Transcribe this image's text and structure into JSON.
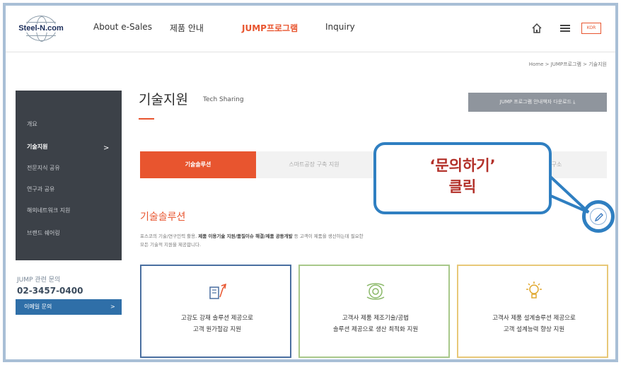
{
  "header": {
    "logo_text": "Steel-N.com",
    "nav": [
      "About e-Sales",
      "제품 안내",
      "JUMP프로그램",
      "Inquiry"
    ],
    "lang_label": "KOR"
  },
  "breadcrumb": "Home  >  JUMP프로그램  >  기술지원",
  "sidebar": {
    "items": [
      "개요",
      "기술지원",
      "전문지식 공유",
      "연구과 공유",
      "해외네트워크 지원",
      "브랜드 쉐어링"
    ],
    "contact_label": "JUMP 관련 문의",
    "contact_phone": "02-3457-0400",
    "email_button": "이메일 문의"
  },
  "main": {
    "title": "기술지원",
    "subtitle": "Tech Sharing",
    "download_button": "JUMP 프로그램 안내책자 다운로드  ⤓",
    "tabs": [
      "기술솔루션",
      "스마트공장 구축 지원",
      "",
      "고전연구소"
    ],
    "section_title": "기술솔루션",
    "description_line1_a": "포스코의 기술/연구인력 활용, ",
    "description_line1_b": "제품 이용기술 지원/품질이슈 해결/제품 공동개발",
    "description_line1_c": " 등 고객이 제품을 생산하는데 필요한",
    "description_line2": "모든 기술적 지원을 제공합니다.",
    "cards": [
      {
        "text": "고강도 강재 솔루션 제공으로\n고객 원가절감 지원",
        "border": "#4a6fa0",
        "icon": "steel-solution-icon"
      },
      {
        "text": "고객사 제품 제조기술/공법\n솔루션 제공으로 생산 최적화 지원",
        "border": "#a8c88a",
        "icon": "manufacturing-icon"
      },
      {
        "text": "고객사 제품 설계솔루션 제공으로\n고객 설계능력 향상 지원",
        "border": "#e8c878",
        "icon": "lightbulb-icon"
      }
    ]
  },
  "callout": {
    "text": "‘문의하기’\n클릭"
  },
  "colors": {
    "accent": "#e8552f",
    "sidebar": "#3c4148",
    "callout_border": "#2f7fc1",
    "callout_text": "#b3312a"
  }
}
